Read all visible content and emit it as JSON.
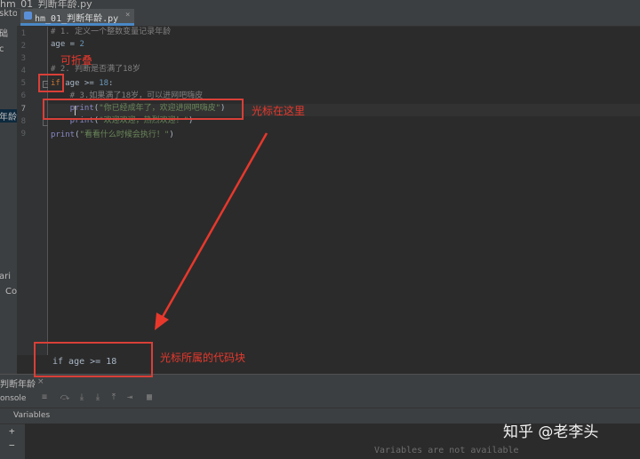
{
  "window": {
    "title_fragment": "hm_01_判断年龄.py"
  },
  "project_panel": {
    "items": [
      "skto",
      "础",
      "c",
      "年龄",
      "ari",
      "Co"
    ]
  },
  "editor_tab": {
    "file_name": "hm_01_判断年龄.py",
    "close_glyph": "×"
  },
  "editor": {
    "line_numbers": [
      "1",
      "2",
      "3",
      "4",
      "5",
      "6",
      "7",
      "8",
      "9"
    ],
    "lines": [
      {
        "parts": [
          {
            "cls": "cm",
            "text": "# 1. 定义一个整数变量记录年龄"
          }
        ]
      },
      {
        "parts": [
          {
            "cls": "",
            "text": "age = "
          },
          {
            "cls": "num",
            "text": "2"
          }
        ]
      },
      {
        "parts": [
          {
            "cls": "cm",
            "text": "# 2. 判断是否满了18岁"
          }
        ]
      },
      {
        "parts": [
          {
            "cls": "kw",
            "text": "if"
          },
          {
            "cls": "",
            "text": " age >= "
          },
          {
            "cls": "num",
            "text": "18"
          },
          {
            "cls": "",
            "text": ":"
          }
        ]
      },
      {
        "parts": [
          {
            "cls": "cm",
            "text": "    # 3.如果满了18岁，可以进网吧嗨皮"
          }
        ]
      },
      {
        "parts": [
          {
            "cls": "fn",
            "text": "    print"
          },
          {
            "cls": "",
            "text": "("
          },
          {
            "cls": "str",
            "text": "\"你已经成年了，欢迎进网吧嗨皮\""
          },
          {
            "cls": "",
            "text": ")"
          }
        ]
      },
      {
        "parts": [
          {
            "cls": "fn",
            "text": "    print"
          },
          {
            "cls": "",
            "text": "("
          },
          {
            "cls": "str",
            "text": "\"欢迎欢迎，热烈欢迎！\""
          },
          {
            "cls": "",
            "text": ")"
          }
        ]
      },
      {
        "parts": [
          {
            "cls": "fn",
            "text": "print"
          },
          {
            "cls": "",
            "text": "("
          },
          {
            "cls": "str",
            "text": "\"看看什么时候会执行！\""
          },
          {
            "cls": "",
            "text": ")"
          }
        ]
      }
    ],
    "breadcrumb": "if age >= 18"
  },
  "run_panel": {
    "tab_label": "判断年龄",
    "tab_close": "×",
    "console_label": "onsole",
    "variables_header": "Variables",
    "add_glyph": "+",
    "remove_glyph": "−",
    "empty_message": "Variables are not available"
  },
  "annotations": {
    "foldable": "可折叠",
    "cursor_here": "光标在这里",
    "code_block": "光标所属的代码块",
    "color": "#e8382c"
  },
  "watermark": "知乎 @老李头"
}
